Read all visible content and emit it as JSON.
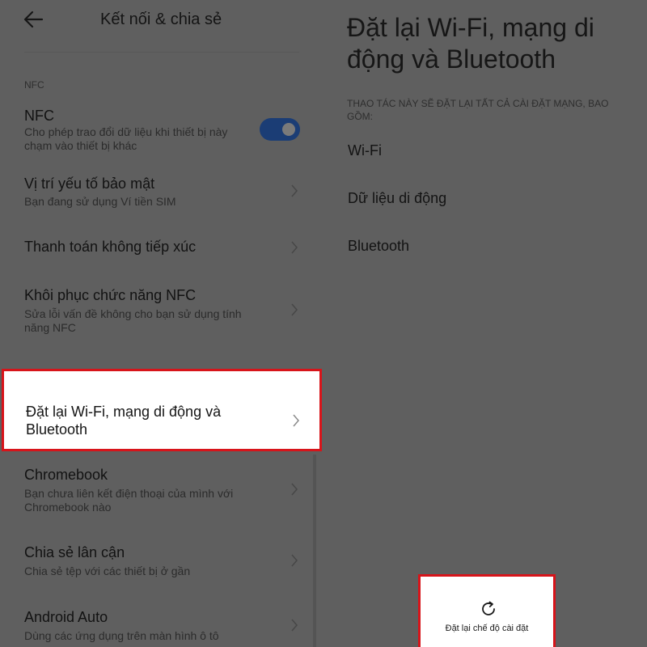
{
  "left": {
    "header": {
      "title": "Kết nối & chia sẻ",
      "back_icon": "arrow-left-icon"
    },
    "section_label": "NFC",
    "nfc": {
      "title": "NFC",
      "subtitle": "Cho phép trao đổi dữ liệu khi thiết bị này chạm vào thiết bị khác",
      "toggle_on": true
    },
    "items": [
      {
        "title": "Vị trí yếu tố bảo mật",
        "subtitle": "Bạn đang sử dụng Ví tiền SIM"
      },
      {
        "title": "Thanh toán không tiếp xúc",
        "subtitle": ""
      },
      {
        "title": "Khôi phục chức năng NFC",
        "subtitle": "Sửa lỗi vấn đề không cho bạn sử dụng tính năng NFC"
      },
      {
        "title": "Đặt lại Wi-Fi, mạng di động và Bluetooth",
        "subtitle": ""
      },
      {
        "title": "Chromebook",
        "subtitle": "Bạn chưa liên kết điện thoại của mình với Chromebook nào"
      },
      {
        "title": "Chia sẻ lân cận",
        "subtitle": "Chia sẻ tệp với các thiết bị ở gần"
      },
      {
        "title": "Android Auto",
        "subtitle": "Dùng các ứng dụng trên màn hình ô tô"
      }
    ]
  },
  "right": {
    "title": "Đặt lại Wi-Fi, mạng di động và Bluetooth",
    "note": "THAO TÁC NÀY SẼ ĐẶT LẠI TẤT CẢ CÀI ĐẶT MẠNG, BAO GỒM:",
    "options": [
      "Wi-Fi",
      "Dữ liệu di động",
      "Bluetooth"
    ],
    "reset_button": {
      "label": "Đặt lại chế độ cài đặt",
      "icon": "refresh-icon"
    }
  },
  "colors": {
    "highlight_border": "#d7141a",
    "toggle_on": "#1b3d75",
    "overlay_background": "#5f5f5f"
  }
}
